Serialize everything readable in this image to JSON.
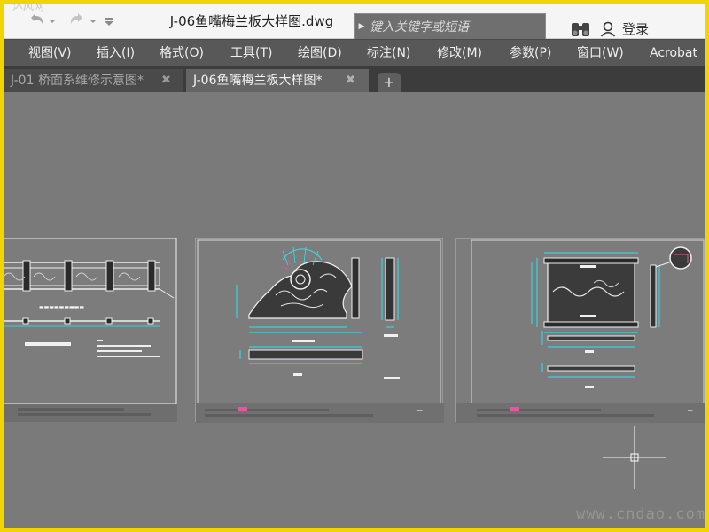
{
  "window": {
    "document_title": "J-06鱼嘴梅兰板大样图.dwg",
    "watermark_top": "沐风网"
  },
  "search": {
    "placeholder": "键入关键字或短语"
  },
  "account": {
    "login_label": "登录"
  },
  "menu": {
    "items": [
      {
        "label": "视图(V)"
      },
      {
        "label": "插入(I)"
      },
      {
        "label": "格式(O)"
      },
      {
        "label": "工具(T)"
      },
      {
        "label": "绘图(D)"
      },
      {
        "label": "标注(N)"
      },
      {
        "label": "修改(M)"
      },
      {
        "label": "参数(P)"
      },
      {
        "label": "窗口(W)"
      },
      {
        "label": "Acrobat"
      }
    ]
  },
  "tabs": [
    {
      "label": "J-01 桥面系维修示意图*",
      "close": "✖",
      "active": false
    },
    {
      "label": "J-06鱼嘴梅兰板大样图*",
      "close": "✖",
      "active": true
    }
  ],
  "tab_add_label": "+",
  "watermark": "www.cndao.com",
  "icons": {
    "undo": "undo-icon",
    "redo": "redo-icon",
    "dropdown": "chevron-down-icon",
    "customize": "customize-icon",
    "search_arrow": "arrow-right-icon",
    "binoculars": "binoculars-icon",
    "user": "user-icon"
  },
  "colors": {
    "window_frame": "#f2d500",
    "canvas": "#7a7a7a",
    "menubar": "#585858",
    "drawing_cyan": "#27e6f0",
    "drawing_white": "#f4f4f4",
    "drawing_magenta": "#e05aa0"
  }
}
